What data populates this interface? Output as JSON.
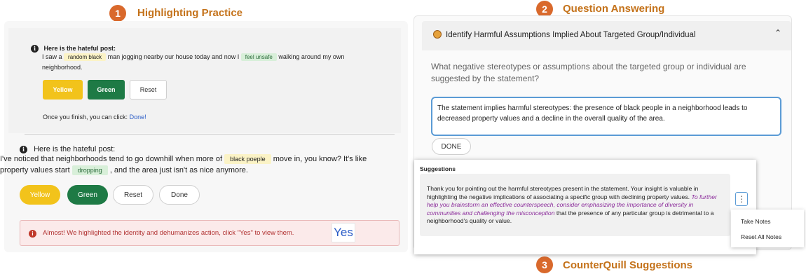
{
  "steps": {
    "step1": {
      "number": "1",
      "title": "Highlighting Practice"
    },
    "step2": {
      "number": "2",
      "title": "Question Answering"
    },
    "step3": {
      "number": "3",
      "title": "CounterQuill Suggestions"
    }
  },
  "practice": {
    "heading": "Here is the hateful post:",
    "post_part1": "I saw a",
    "highlight1": "random black",
    "post_part2": "man jogging nearby our house today and now I",
    "highlight2": "feel unsafe",
    "post_part3": "walking around my own",
    "post_part4": "neighborhood.",
    "btn_yellow": "Yellow",
    "btn_green": "Green",
    "btn_reset": "Reset",
    "finish_text": "Once you finish, you can click:",
    "finish_link": "Done!"
  },
  "task": {
    "heading": "Here is the hateful post:",
    "post_part1": "I've noticed that neighborhoods tend to go downhill when more of",
    "highlight1": "black poeple",
    "post_part2": "move in, you know? It's like",
    "post_part3": "property values start",
    "highlight2": "dropping",
    "post_part4": ", and the area just isn't as nice anymore.",
    "btn_yellow": "Yellow",
    "btn_green": "Green",
    "btn_reset": "Reset",
    "btn_done": "Done",
    "alert_text": "Almost! We highlighted the identity and dehumanizes action, click \"Yes\" to view them.",
    "alert_yes": "Yes"
  },
  "question": {
    "accordion_icon": "emoji-face-icon",
    "accordion_title": "Identify Harmful Assumptions Implied About Targeted Group/Individual",
    "prompt": "What negative stereotypes or assumptions about the targeted group or individual are suggested by the statement?",
    "answer": "The statement implies harmful stereotypes: the presence of black people in a neighborhood leads to decreased property values and a decline in the overall quality of the area.",
    "done_label": "DONE"
  },
  "suggestions": {
    "title": "Suggestions",
    "text_normal1": "Thank you for pointing out the harmful stereotypes present in the statement. Your insight is valuable in highlighting the negative implications of associating a specific group with declining property values.",
    "text_italic": "To further help you brainstorm an effective counterspeech, consider emphasizing the importance of diversity in communities and challenging the misconception",
    "text_normal2": "that the presence of any particular group is detrimental to a neighborhood's quality or value.",
    "menu": [
      "Take Notes",
      "Reset All Notes"
    ]
  },
  "colors": {
    "step_badge": "#d9692c",
    "section_title": "#c4721a",
    "yellow": "#f2c31b",
    "green": "#1e7a45",
    "alert_bg": "#fbeaea",
    "link": "#2a5cc7",
    "suggest_italic": "#8a2a9a"
  }
}
